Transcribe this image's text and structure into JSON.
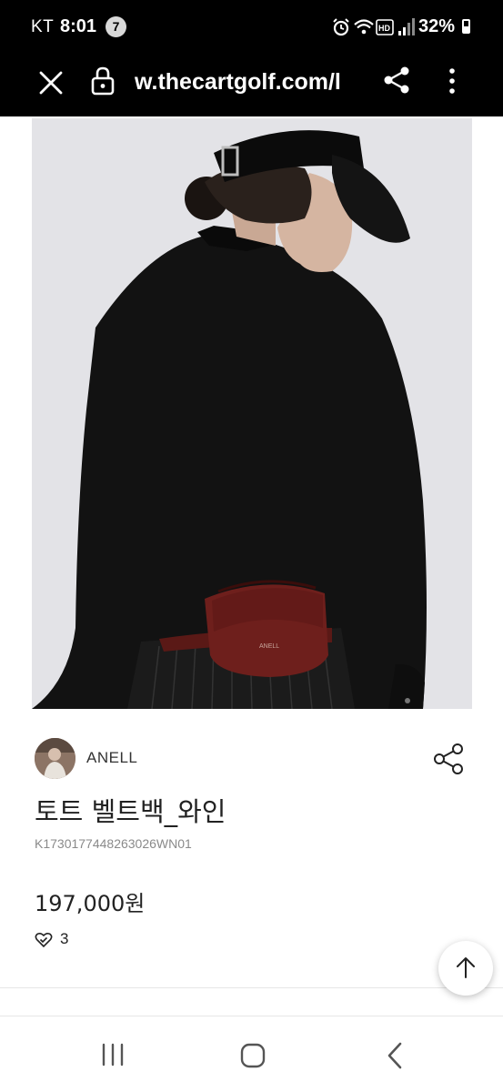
{
  "status_bar": {
    "carrier": "KT",
    "time": "8:01",
    "notification_count": "7",
    "battery": "32%"
  },
  "browser": {
    "url": "w.thecartgolf.com/l"
  },
  "product": {
    "brand": "ANELL",
    "title": "토트 벨트백_와인",
    "code": "K1730177448263026WN01",
    "price": "197,000원",
    "likes": "3"
  },
  "colors": {
    "bar_background": "#000000",
    "text_primary": "#222222",
    "text_muted": "#8a8a8a",
    "bag_wine": "#6e1f1c"
  }
}
